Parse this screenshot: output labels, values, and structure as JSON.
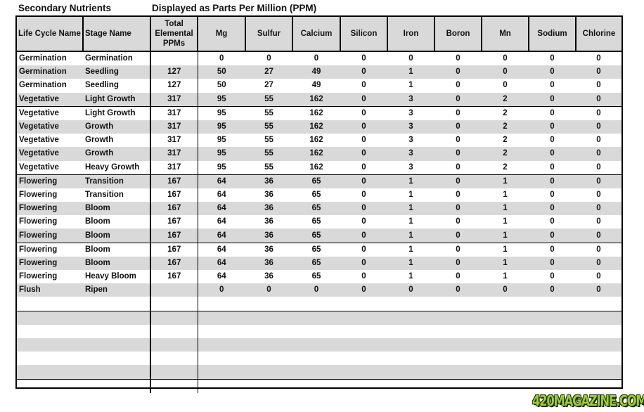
{
  "header": {
    "title": "Secondary Nutrients",
    "subtitle": "Displayed as Parts Per Million (PPM)"
  },
  "table": {
    "columns": [
      "Life Cycle Name",
      "Stage Name",
      "Total Elemental PPMs",
      "Mg",
      "Sulfur",
      "Calcium",
      "Silicon",
      "Iron",
      "Boron",
      "Mn",
      "Sodium",
      "Chlorine"
    ],
    "total_header_lines": [
      "Total",
      "Elemental",
      "PPMs"
    ],
    "rows": [
      [
        "Germination",
        "Germination",
        "",
        "0",
        "0",
        "0",
        "0",
        "0",
        "0",
        "0",
        "0",
        "0"
      ],
      [
        "Germination",
        "Seedling",
        "127",
        "50",
        "27",
        "49",
        "0",
        "1",
        "0",
        "0",
        "0",
        "0"
      ],
      [
        "Germination",
        "Seedling",
        "127",
        "50",
        "27",
        "49",
        "0",
        "1",
        "0",
        "0",
        "0",
        "0"
      ],
      [
        "Vegetative",
        "Light Growth",
        "317",
        "95",
        "55",
        "162",
        "0",
        "3",
        "0",
        "2",
        "0",
        "0"
      ],
      [
        "Vegetative",
        "Light Growth",
        "317",
        "95",
        "55",
        "162",
        "0",
        "3",
        "0",
        "2",
        "0",
        "0"
      ],
      [
        "Vegetative",
        "Growth",
        "317",
        "95",
        "55",
        "162",
        "0",
        "3",
        "0",
        "2",
        "0",
        "0"
      ],
      [
        "Vegetative",
        "Growth",
        "317",
        "95",
        "55",
        "162",
        "0",
        "3",
        "0",
        "2",
        "0",
        "0"
      ],
      [
        "Vegetative",
        "Growth",
        "317",
        "95",
        "55",
        "162",
        "0",
        "3",
        "0",
        "2",
        "0",
        "0"
      ],
      [
        "Vegetative",
        "Heavy Growth",
        "317",
        "95",
        "55",
        "162",
        "0",
        "3",
        "0",
        "2",
        "0",
        "0"
      ],
      [
        "Flowering",
        "Transition",
        "167",
        "64",
        "36",
        "65",
        "0",
        "1",
        "0",
        "1",
        "0",
        "0"
      ],
      [
        "Flowering",
        "Transition",
        "167",
        "64",
        "36",
        "65",
        "0",
        "1",
        "0",
        "1",
        "0",
        "0"
      ],
      [
        "Flowering",
        "Bloom",
        "167",
        "64",
        "36",
        "65",
        "0",
        "1",
        "0",
        "1",
        "0",
        "0"
      ],
      [
        "Flowering",
        "Bloom",
        "167",
        "64",
        "36",
        "65",
        "0",
        "1",
        "0",
        "1",
        "0",
        "0"
      ],
      [
        "Flowering",
        "Bloom",
        "167",
        "64",
        "36",
        "65",
        "0",
        "1",
        "0",
        "1",
        "0",
        "0"
      ],
      [
        "Flowering",
        "Bloom",
        "167",
        "64",
        "36",
        "65",
        "0",
        "1",
        "0",
        "1",
        "0",
        "0"
      ],
      [
        "Flowering",
        "Bloom",
        "167",
        "64",
        "36",
        "65",
        "0",
        "1",
        "0",
        "1",
        "0",
        "0"
      ],
      [
        "Flowering",
        "Heavy Bloom",
        "167",
        "64",
        "36",
        "65",
        "0",
        "1",
        "0",
        "1",
        "0",
        "0"
      ],
      [
        "Flush",
        "Ripen",
        "",
        "0",
        "0",
        "0",
        "0",
        "0",
        "0",
        "0",
        "0",
        "0"
      ]
    ],
    "empty_rows": 7
  },
  "watermark": {
    "text": "420MAGAZINE.COM"
  },
  "colors": {
    "header_bg": "#d9d9d9",
    "stripe_bg": "#d9d9d9",
    "watermark_green": "#9ccc3a"
  }
}
